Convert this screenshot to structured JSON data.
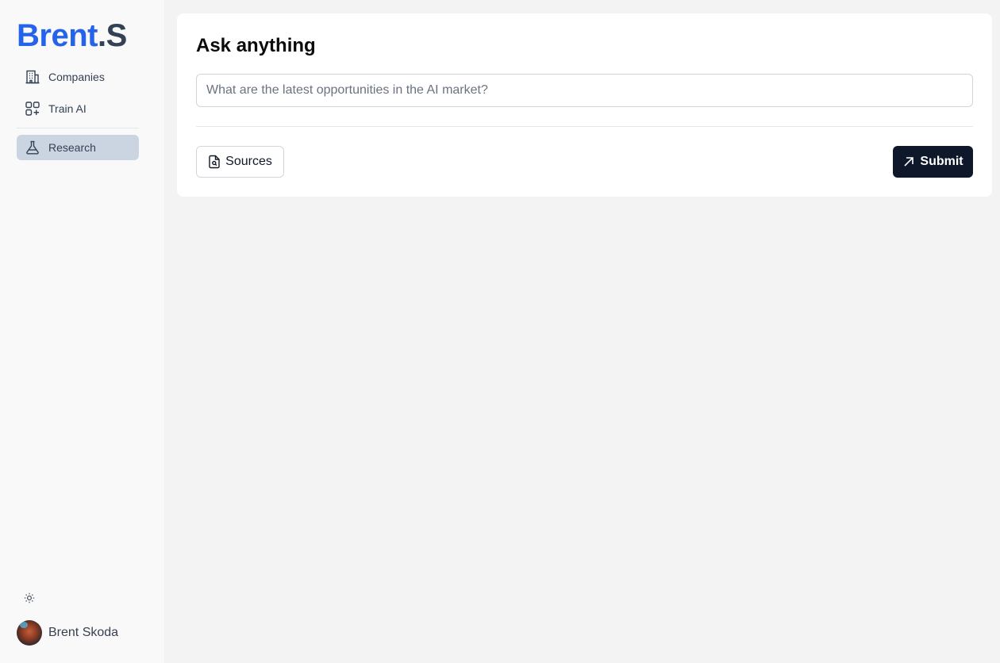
{
  "brand": {
    "part1": "Brent",
    "part2": ".S"
  },
  "sidebar": {
    "items": [
      {
        "label": "Companies",
        "icon": "building-icon",
        "active": false
      },
      {
        "label": "Train AI",
        "icon": "apps-add-icon",
        "active": false
      },
      {
        "label": "Research",
        "icon": "flask-icon",
        "active": true
      }
    ]
  },
  "user": {
    "name": "Brent Skoda"
  },
  "main": {
    "title": "Ask anything",
    "query": {
      "placeholder": "What are the latest opportunities in the AI market?",
      "value": ""
    },
    "sources_label": "Sources",
    "submit_label": "Submit"
  },
  "colors": {
    "brand_blue": "#2563eb",
    "brand_slate": "#334155",
    "active_nav": "#cbd5e1",
    "submit_bg": "#0f172a"
  }
}
